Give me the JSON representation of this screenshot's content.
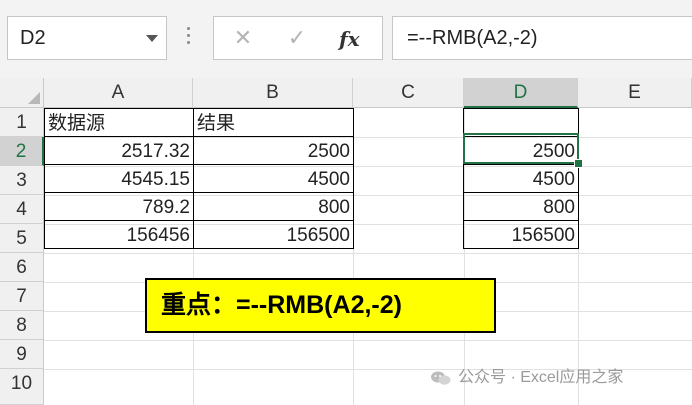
{
  "formula_bar": {
    "name_box": "D2",
    "cancel_glyph": "✕",
    "enter_glyph": "✓",
    "fx_label": "fx",
    "formula": "=--RMB(A2,-2)"
  },
  "columns": [
    "A",
    "B",
    "C",
    "D",
    "E"
  ],
  "rows": [
    "1",
    "2",
    "3",
    "4",
    "5",
    "6",
    "7",
    "8",
    "9",
    "10"
  ],
  "selected": {
    "column": "D",
    "row": "2"
  },
  "table": {
    "header": [
      "数据源",
      "结果"
    ],
    "rows": [
      [
        "2517.32",
        "2500"
      ],
      [
        "4545.15",
        "4500"
      ],
      [
        "789.2",
        "800"
      ],
      [
        "156456",
        "156500"
      ]
    ]
  },
  "column_d": [
    "",
    "2500",
    "4500",
    "800",
    "156500"
  ],
  "callout": "重点：=--RMB(A2,-2)",
  "watermark": "公众号 · Excel应用之家",
  "colors": {
    "accent": "#217346",
    "callout_bg": "#ffff00"
  }
}
